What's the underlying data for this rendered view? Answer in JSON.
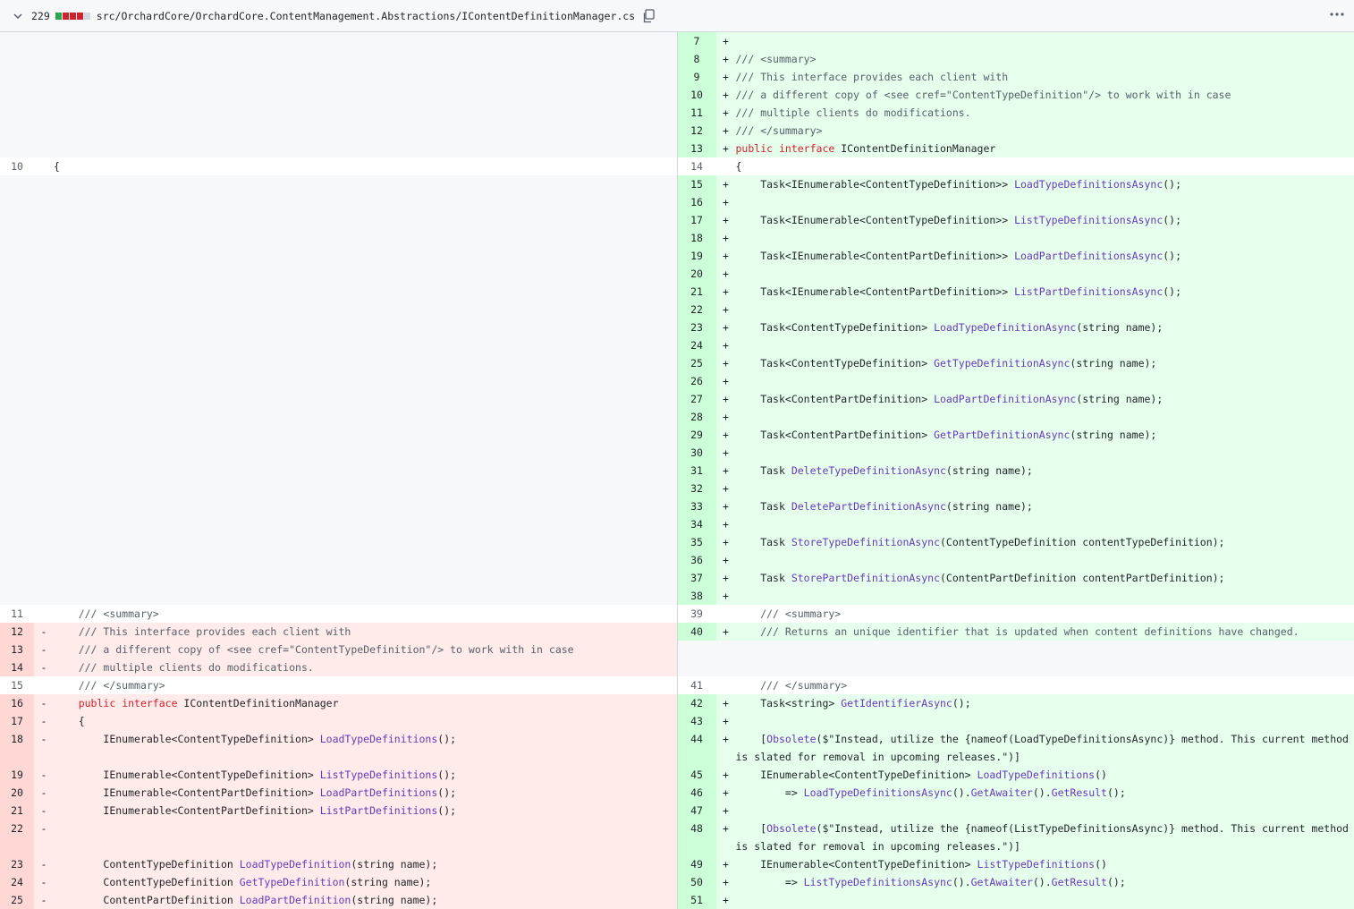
{
  "file": {
    "changed_lines": "229",
    "path": "src/OrchardCore/OrchardCore.ContentManagement.Abstractions/IContentDefinitionManager.cs",
    "colors": {
      "added": "#2da44e",
      "removed": "#cf222e",
      "neutral": "#d0d7de"
    }
  },
  "diff_rows": [
    {
      "l": {
        "type": "empty"
      },
      "r": {
        "type": "add",
        "num": "7",
        "text": ""
      }
    },
    {
      "l": {
        "type": "empty"
      },
      "r": {
        "type": "add",
        "num": "8",
        "text": "/// <summary>"
      }
    },
    {
      "l": {
        "type": "empty"
      },
      "r": {
        "type": "add",
        "num": "9",
        "text": "/// This interface provides each client with"
      }
    },
    {
      "l": {
        "type": "empty"
      },
      "r": {
        "type": "add",
        "num": "10",
        "text": "/// a different copy of <see cref=\"ContentTypeDefinition\"/> to work with in case"
      }
    },
    {
      "l": {
        "type": "empty"
      },
      "r": {
        "type": "add",
        "num": "11",
        "text": "/// multiple clients do modifications."
      }
    },
    {
      "l": {
        "type": "empty"
      },
      "r": {
        "type": "add",
        "num": "12",
        "text": "/// </summary>"
      }
    },
    {
      "l": {
        "type": "empty"
      },
      "r": {
        "type": "add",
        "num": "13",
        "text": "public interface IContentDefinitionManager"
      }
    },
    {
      "l": {
        "type": "ctx",
        "num": "10",
        "text": "{"
      },
      "r": {
        "type": "ctx",
        "num": "14",
        "text": "{"
      }
    },
    {
      "l": {
        "type": "empty"
      },
      "r": {
        "type": "add",
        "num": "15",
        "text": "    Task<IEnumerable<ContentTypeDefinition>> LoadTypeDefinitionsAsync();"
      }
    },
    {
      "l": {
        "type": "empty"
      },
      "r": {
        "type": "add",
        "num": "16",
        "text": ""
      }
    },
    {
      "l": {
        "type": "empty"
      },
      "r": {
        "type": "add",
        "num": "17",
        "text": "    Task<IEnumerable<ContentTypeDefinition>> ListTypeDefinitionsAsync();"
      }
    },
    {
      "l": {
        "type": "empty"
      },
      "r": {
        "type": "add",
        "num": "18",
        "text": ""
      }
    },
    {
      "l": {
        "type": "empty"
      },
      "r": {
        "type": "add",
        "num": "19",
        "text": "    Task<IEnumerable<ContentPartDefinition>> LoadPartDefinitionsAsync();"
      }
    },
    {
      "l": {
        "type": "empty"
      },
      "r": {
        "type": "add",
        "num": "20",
        "text": ""
      }
    },
    {
      "l": {
        "type": "empty"
      },
      "r": {
        "type": "add",
        "num": "21",
        "text": "    Task<IEnumerable<ContentPartDefinition>> ListPartDefinitionsAsync();"
      }
    },
    {
      "l": {
        "type": "empty"
      },
      "r": {
        "type": "add",
        "num": "22",
        "text": ""
      }
    },
    {
      "l": {
        "type": "empty"
      },
      "r": {
        "type": "add",
        "num": "23",
        "text": "    Task<ContentTypeDefinition> LoadTypeDefinitionAsync(string name);"
      }
    },
    {
      "l": {
        "type": "empty"
      },
      "r": {
        "type": "add",
        "num": "24",
        "text": ""
      }
    },
    {
      "l": {
        "type": "empty"
      },
      "r": {
        "type": "add",
        "num": "25",
        "text": "    Task<ContentTypeDefinition> GetTypeDefinitionAsync(string name);"
      }
    },
    {
      "l": {
        "type": "empty"
      },
      "r": {
        "type": "add",
        "num": "26",
        "text": ""
      }
    },
    {
      "l": {
        "type": "empty"
      },
      "r": {
        "type": "add",
        "num": "27",
        "text": "    Task<ContentPartDefinition> LoadPartDefinitionAsync(string name);"
      }
    },
    {
      "l": {
        "type": "empty"
      },
      "r": {
        "type": "add",
        "num": "28",
        "text": ""
      }
    },
    {
      "l": {
        "type": "empty"
      },
      "r": {
        "type": "add",
        "num": "29",
        "text": "    Task<ContentPartDefinition> GetPartDefinitionAsync(string name);"
      }
    },
    {
      "l": {
        "type": "empty"
      },
      "r": {
        "type": "add",
        "num": "30",
        "text": ""
      }
    },
    {
      "l": {
        "type": "empty"
      },
      "r": {
        "type": "add",
        "num": "31",
        "text": "    Task DeleteTypeDefinitionAsync(string name);"
      }
    },
    {
      "l": {
        "type": "empty"
      },
      "r": {
        "type": "add",
        "num": "32",
        "text": ""
      }
    },
    {
      "l": {
        "type": "empty"
      },
      "r": {
        "type": "add",
        "num": "33",
        "text": "    Task DeletePartDefinitionAsync(string name);"
      }
    },
    {
      "l": {
        "type": "empty"
      },
      "r": {
        "type": "add",
        "num": "34",
        "text": ""
      }
    },
    {
      "l": {
        "type": "empty"
      },
      "r": {
        "type": "add",
        "num": "35",
        "text": "    Task StoreTypeDefinitionAsync(ContentTypeDefinition contentTypeDefinition);"
      }
    },
    {
      "l": {
        "type": "empty"
      },
      "r": {
        "type": "add",
        "num": "36",
        "text": ""
      }
    },
    {
      "l": {
        "type": "empty"
      },
      "r": {
        "type": "add",
        "num": "37",
        "text": "    Task StorePartDefinitionAsync(ContentPartDefinition contentPartDefinition);"
      }
    },
    {
      "l": {
        "type": "empty"
      },
      "r": {
        "type": "add",
        "num": "38",
        "text": ""
      }
    },
    {
      "l": {
        "type": "ctx",
        "num": "11",
        "text": "    /// <summary>"
      },
      "r": {
        "type": "ctx",
        "num": "39",
        "text": "    /// <summary>"
      }
    },
    {
      "l": {
        "type": "del",
        "num": "12",
        "text": "    /// This interface provides each client with"
      },
      "r": {
        "type": "add",
        "num": "40",
        "text": "    /// Returns an unique identifier that is updated when content definitions have changed."
      }
    },
    {
      "l": {
        "type": "del",
        "num": "13",
        "text": "    /// a different copy of <see cref=\"ContentTypeDefinition\"/> to work with in case"
      },
      "r": {
        "type": "empty"
      }
    },
    {
      "l": {
        "type": "del",
        "num": "14",
        "text": "    /// multiple clients do modifications."
      },
      "r": {
        "type": "empty"
      }
    },
    {
      "l": {
        "type": "ctx",
        "num": "15",
        "text": "    /// </summary>"
      },
      "r": {
        "type": "ctx",
        "num": "41",
        "text": "    /// </summary>"
      }
    },
    {
      "l": {
        "type": "del",
        "num": "16",
        "text": "    public interface IContentDefinitionManager"
      },
      "r": {
        "type": "add",
        "num": "42",
        "text": "    Task<string> GetIdentifierAsync();"
      }
    },
    {
      "l": {
        "type": "del",
        "num": "17",
        "text": "    {"
      },
      "r": {
        "type": "add",
        "num": "43",
        "text": ""
      }
    },
    {
      "tall": true,
      "l": {
        "type": "del",
        "num": "18",
        "text": "        IEnumerable<ContentTypeDefinition> LoadTypeDefinitions();"
      },
      "r": {
        "type": "add",
        "num": "44",
        "text": "    [Obsolete($\"Instead, utilize the {nameof(LoadTypeDefinitionsAsync)} method. This current method is slated for removal in upcoming releases.\")]"
      }
    },
    {
      "l": {
        "type": "del",
        "num": "19",
        "text": "        IEnumerable<ContentTypeDefinition> ListTypeDefinitions();"
      },
      "r": {
        "type": "add",
        "num": "45",
        "text": "    IEnumerable<ContentTypeDefinition> LoadTypeDefinitions()"
      }
    },
    {
      "l": {
        "type": "del",
        "num": "20",
        "text": "        IEnumerable<ContentPartDefinition> LoadPartDefinitions();"
      },
      "r": {
        "type": "add",
        "num": "46",
        "text": "        => LoadTypeDefinitionsAsync().GetAwaiter().GetResult();"
      }
    },
    {
      "l": {
        "type": "del",
        "num": "21",
        "text": "        IEnumerable<ContentPartDefinition> ListPartDefinitions();"
      },
      "r": {
        "type": "add",
        "num": "47",
        "text": ""
      }
    },
    {
      "tall": true,
      "l": {
        "type": "del",
        "num": "22",
        "text": ""
      },
      "r": {
        "type": "add",
        "num": "48",
        "text": "    [Obsolete($\"Instead, utilize the {nameof(ListTypeDefinitionsAsync)} method. This current method is slated for removal in upcoming releases.\")]"
      }
    },
    {
      "l": {
        "type": "del",
        "num": "23",
        "text": "        ContentTypeDefinition LoadTypeDefinition(string name);"
      },
      "r": {
        "type": "add",
        "num": "49",
        "text": "    IEnumerable<ContentTypeDefinition> ListTypeDefinitions()"
      }
    },
    {
      "l": {
        "type": "del",
        "num": "24",
        "text": "        ContentTypeDefinition GetTypeDefinition(string name);"
      },
      "r": {
        "type": "add",
        "num": "50",
        "text": "        => ListTypeDefinitionsAsync().GetAwaiter().GetResult();"
      }
    },
    {
      "l": {
        "type": "del",
        "num": "25",
        "text": "        ContentPartDefinition LoadPartDefinition(string name);"
      },
      "r": {
        "type": "add",
        "num": "51",
        "text": ""
      }
    }
  ]
}
